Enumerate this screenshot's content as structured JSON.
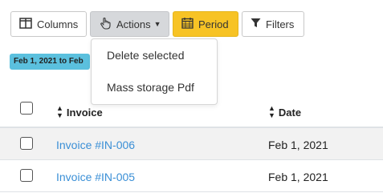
{
  "toolbar": {
    "columns_label": "Columns",
    "actions_label": "Actions",
    "period_label": "Period",
    "filters_label": "Filters",
    "icons": {
      "columns": "columns-icon",
      "actions": "hand-pointer-icon",
      "period": "calendar-icon",
      "filters": "filter-icon"
    },
    "colors": {
      "period_bg": "#f7c325",
      "actions_bg": "#d6d8db"
    }
  },
  "period_badge": {
    "text": "Feb 1, 2021 to Feb",
    "color": "#5bc0de"
  },
  "actions_menu": {
    "items": [
      "Delete selected",
      "Mass storage Pdf"
    ]
  },
  "table": {
    "columns": [
      "Invoice",
      "Date"
    ],
    "rows": [
      {
        "invoice": "Invoice #IN-006",
        "date": "Feb 1, 2021"
      },
      {
        "invoice": "Invoice #IN-005",
        "date": "Feb 1, 2021"
      }
    ],
    "link_color": "#3a8fd6"
  }
}
